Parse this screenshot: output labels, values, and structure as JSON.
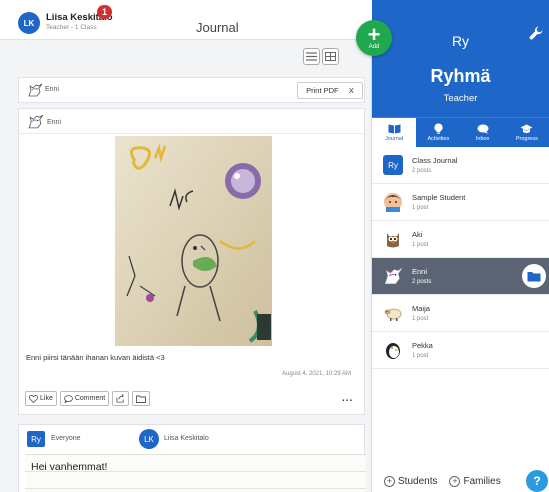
{
  "header": {
    "user_initials": "LK",
    "user_name": "Liisa Keskitalo",
    "user_role": "Teacher - 1 Class",
    "notification_count": "1",
    "title": "Journal"
  },
  "fab": {
    "label": "Add",
    "icon": "plus-icon"
  },
  "post_toolbar": {
    "author": "Enni",
    "print_label": "Print PDF",
    "close_label": "X"
  },
  "post": {
    "author": "Enni",
    "caption": "Enni piirsi tänään ihanan kuvan äidistä <3",
    "timestamp": "August 4, 2021, 10:29 AM",
    "like_label": "Like",
    "comment_label": "Comment",
    "more_label": "..."
  },
  "composer": {
    "audience_badge": "Ry",
    "audience": "Everyone",
    "author_initials": "LK",
    "author_name": "Liisa Keskitalo",
    "text": "Hei vanhemmat!"
  },
  "sidebar": {
    "class_short": "Ry",
    "class_name": "Ryhmä",
    "role": "Teacher",
    "tabs": [
      {
        "label": "Journal",
        "icon": "book-icon",
        "active": true
      },
      {
        "label": "Activities",
        "icon": "lightbulb-icon",
        "active": false
      },
      {
        "label": "Inbox",
        "icon": "chat-icon",
        "active": false
      },
      {
        "label": "Progress",
        "icon": "graduation-cap-icon",
        "active": false
      }
    ],
    "items": [
      {
        "name": "Class Journal",
        "posts": "2 posts",
        "avatar": "Ry"
      },
      {
        "name": "Sample Student",
        "posts": "1 post",
        "avatar": "student-avatar"
      },
      {
        "name": "Aki",
        "posts": "1 post",
        "avatar": "owl-avatar"
      },
      {
        "name": "Enni",
        "posts": "2 posts",
        "avatar": "unicorn-avatar",
        "active": true
      },
      {
        "name": "Maija",
        "posts": "1 post",
        "avatar": "sheep-avatar"
      },
      {
        "name": "Pekka",
        "posts": "1 post",
        "avatar": "penguin-avatar"
      }
    ],
    "students_label": "Students",
    "families_label": "Families",
    "help_label": "?"
  },
  "colors": {
    "brand_blue": "#1f66c9",
    "fab_green": "#20a84f",
    "active_row": "#5b6474",
    "notification_red": "#d32f2f"
  }
}
